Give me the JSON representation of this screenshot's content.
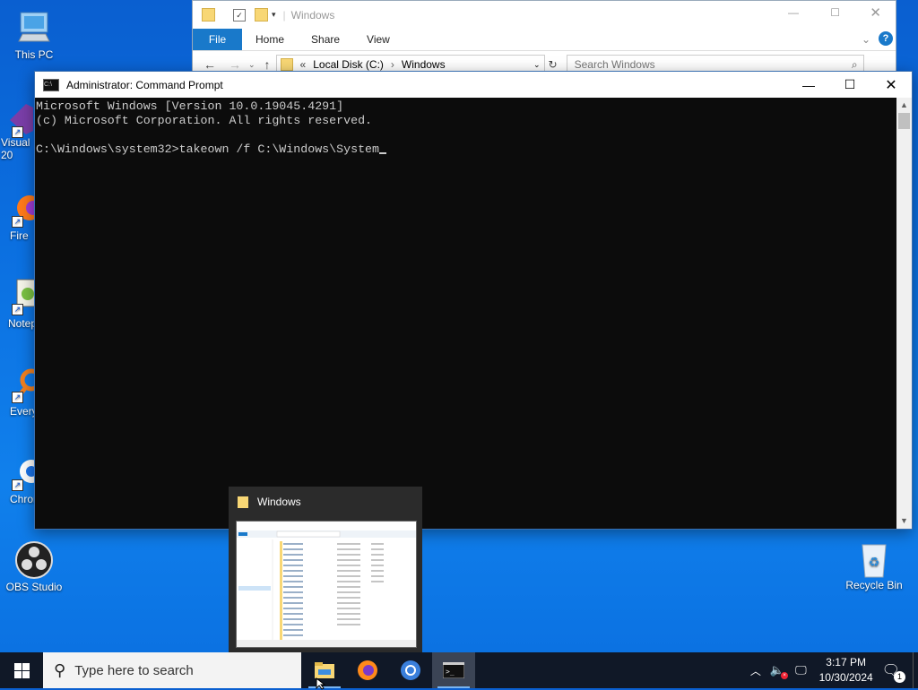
{
  "desktop_icons": [
    {
      "label": "This PC"
    },
    {
      "label": "Visual\n20"
    },
    {
      "label": "Fire"
    },
    {
      "label": "Notep"
    },
    {
      "label": "Every"
    },
    {
      "label": "Chron"
    },
    {
      "label": "OBS Studio"
    },
    {
      "label": "Recycle Bin"
    }
  ],
  "explorer": {
    "title": "Windows",
    "ribbon": {
      "file": "File",
      "tabs": [
        "Home",
        "Share",
        "View"
      ]
    },
    "path": [
      "Local Disk (C:)",
      "Windows"
    ],
    "search_placeholder": "Search Windows"
  },
  "cmd": {
    "title": "Administrator: Command Prompt",
    "lines": [
      "Microsoft Windows [Version 10.0.19045.4291]",
      "(c) Microsoft Corporation. All rights reserved.",
      "",
      "C:\\Windows\\system32>takeown /f C:\\Windows\\System"
    ]
  },
  "thumbnail": {
    "title": "Windows"
  },
  "taskbar": {
    "search_placeholder": "Type here to search",
    "time": "3:17 PM",
    "date": "10/30/2024",
    "notification_count": "1"
  },
  "colors": {
    "accent": "#1979ca",
    "console_bg": "#0c0c0c",
    "console_fg": "#cccccc",
    "taskbar": "#101827"
  }
}
